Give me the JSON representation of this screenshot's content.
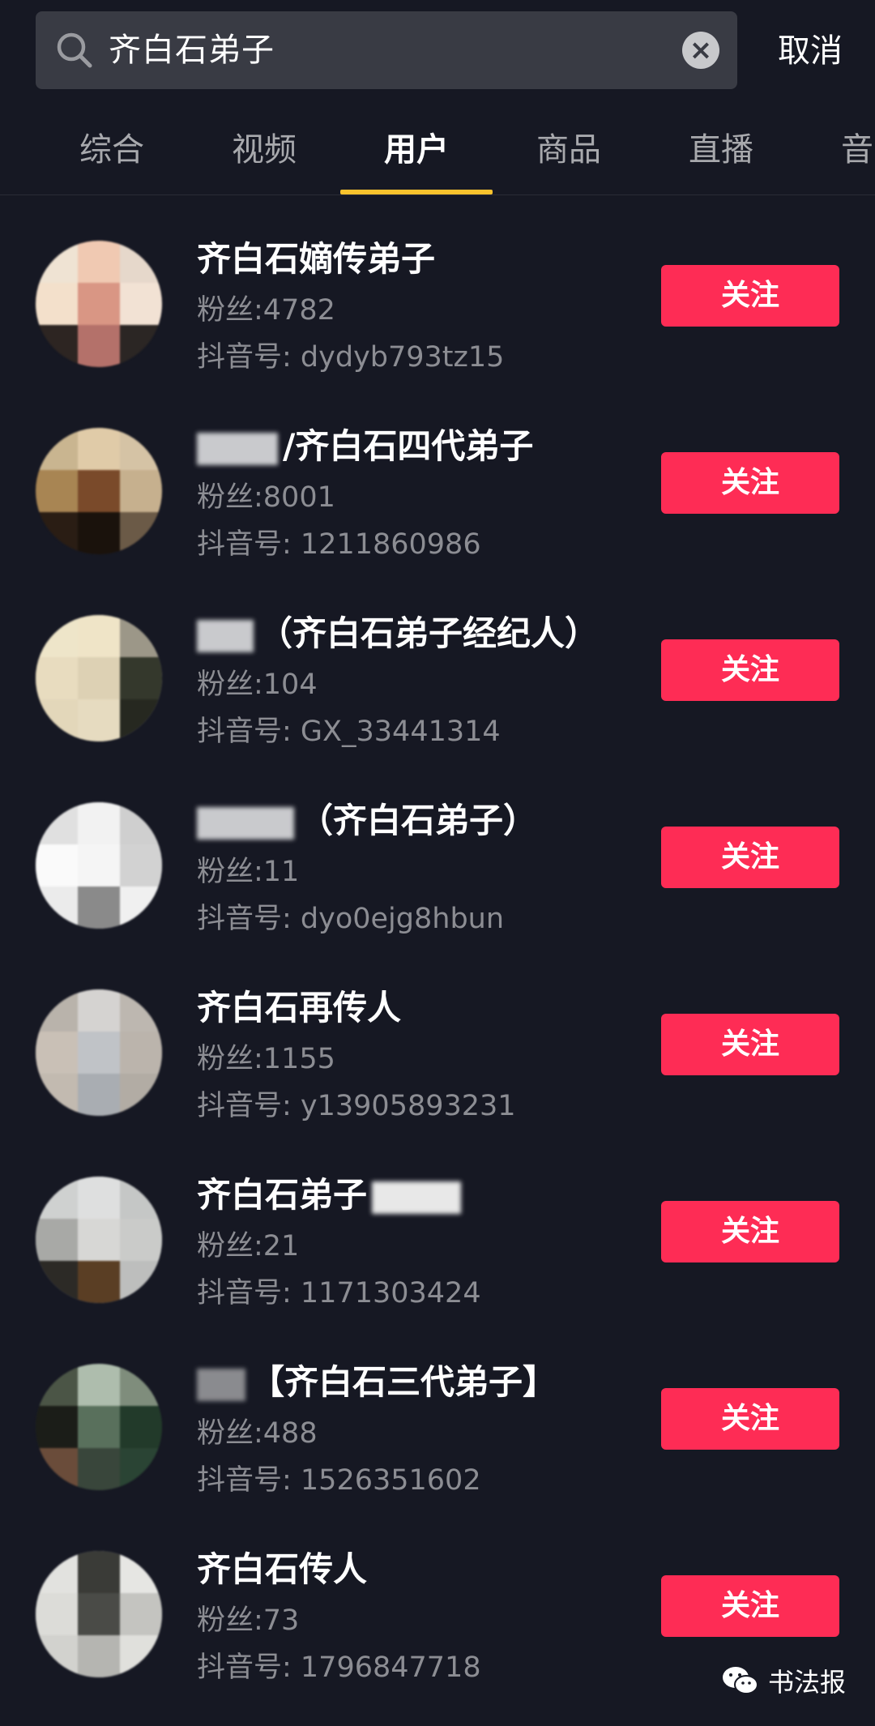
{
  "search": {
    "query": "齐白石弟子",
    "cancel_label": "取消"
  },
  "tabs": [
    {
      "label": "综合"
    },
    {
      "label": "视频"
    },
    {
      "label": "用户"
    },
    {
      "label": "商品"
    },
    {
      "label": "直播"
    },
    {
      "label": "音"
    }
  ],
  "active_tab": "用户",
  "colors": {
    "background": "#161823",
    "accent_underline": "#f9c22d",
    "follow_button": "#fe2c55",
    "muted_text": "#8c8d93"
  },
  "users": [
    {
      "name": "齐白石嫡传弟子",
      "fans": "粉丝:4782",
      "douyin_id": "抖音号: dydyb793tz15",
      "follow_label": "关注"
    },
    {
      "name": "/齐白石四代弟子",
      "fans": "粉丝:8001",
      "douyin_id": "抖音号: 1211860986",
      "follow_label": "关注"
    },
    {
      "name": "（齐白石弟子经纪人）",
      "fans": "粉丝:104",
      "douyin_id": "抖音号: GX_33441314",
      "follow_label": "关注"
    },
    {
      "name": "（齐白石弟子）",
      "fans": "粉丝:11",
      "douyin_id": "抖音号: dyo0ejg8hbun",
      "follow_label": "关注"
    },
    {
      "name": "齐白石再传人",
      "fans": "粉丝:1155",
      "douyin_id": "抖音号: y13905893231",
      "follow_label": "关注"
    },
    {
      "name": "齐白石弟子",
      "fans": "粉丝:21",
      "douyin_id": "抖音号: 1171303424",
      "follow_label": "关注"
    },
    {
      "name": "【齐白石三代弟子】",
      "fans": "粉丝:488",
      "douyin_id": "抖音号: 1526351602",
      "follow_label": "关注"
    },
    {
      "name": "齐白石传人",
      "fans": "粉丝:73",
      "douyin_id": "抖音号: 1796847718",
      "follow_label": "关注"
    }
  ],
  "watermark": {
    "icon": "wechat-icon",
    "text": "书法报"
  }
}
